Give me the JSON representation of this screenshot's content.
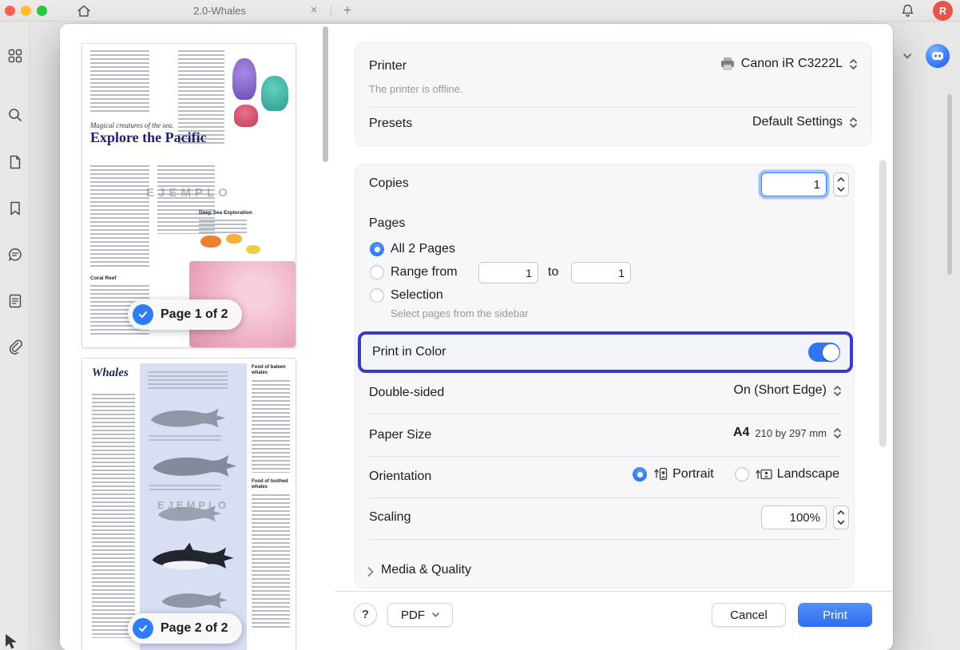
{
  "titlebar": {
    "tab_title": "2.0-Whales",
    "close_label": "×",
    "new_tab_label": "+",
    "avatar_letter": "R"
  },
  "thumbnails": {
    "page1": {
      "badge": "Page 1 of 2",
      "kicker": "Magical creatures of the sea.",
      "title": "Explore the Pacific",
      "watermark": "EJEMPLO",
      "subhead_coral": "Coral Reef",
      "subhead_deep": "Deep Sea Exploration"
    },
    "page2": {
      "badge": "Page 2 of 2",
      "title": "Whales",
      "watermark": "EJEMPLO",
      "subhead_baleen": "Food of baleen whales",
      "subhead_toothed": "Food of toothed whales"
    }
  },
  "dialog": {
    "printer": {
      "label": "Printer",
      "value": "Canon iR C3222L",
      "status": "The printer is offline."
    },
    "presets": {
      "label": "Presets",
      "value": "Default Settings"
    },
    "copies": {
      "label": "Copies",
      "value": "1"
    },
    "pages": {
      "label": "Pages",
      "all_label": "All 2 Pages",
      "range_label": "Range from",
      "range_from": "1",
      "to_label": "to",
      "range_to": "1",
      "selection_label": "Selection",
      "selection_hint": "Select pages from the sidebar"
    },
    "color": {
      "label": "Print in Color",
      "state": "on"
    },
    "double_sided": {
      "label": "Double-sided",
      "value": "On (Short Edge)"
    },
    "paper": {
      "label": "Paper Size",
      "value": "A4",
      "detail": "210 by 297 mm"
    },
    "orientation": {
      "label": "Orientation",
      "portrait": "Portrait",
      "landscape": "Landscape"
    },
    "scaling": {
      "label": "Scaling",
      "value": "100%"
    },
    "media_quality": "Media & Quality",
    "footer": {
      "help": "?",
      "pdf": "PDF",
      "cancel": "Cancel",
      "print": "Print"
    }
  },
  "colors": {
    "accent_blue": "#2E7CF6",
    "highlight_border": "#3B3AC4",
    "print_button": "#2D6EF0",
    "avatar": "#E2574C",
    "thumbnail_band": "#D8DEF4"
  },
  "icons": {
    "titlebar": [
      "home-icon",
      "close-icon",
      "plus-icon",
      "bell-icon"
    ],
    "sidebar": [
      "apps-grid-icon",
      "search-icon",
      "file-icon",
      "bookmark-icon",
      "comment-icon",
      "outline-doc-icon",
      "paperclip-icon"
    ],
    "dialog": [
      "printer-icon",
      "dropdown-chevrons-icon",
      "stepper-up-icon",
      "stepper-down-icon",
      "portrait-icon",
      "landscape-icon",
      "check-circle-icon",
      "disclosure-chevron-icon",
      "pdf-chevron-icon"
    ],
    "misc": [
      "cursor-icon",
      "chevron-down-icon",
      "updf-ai-icon"
    ]
  }
}
